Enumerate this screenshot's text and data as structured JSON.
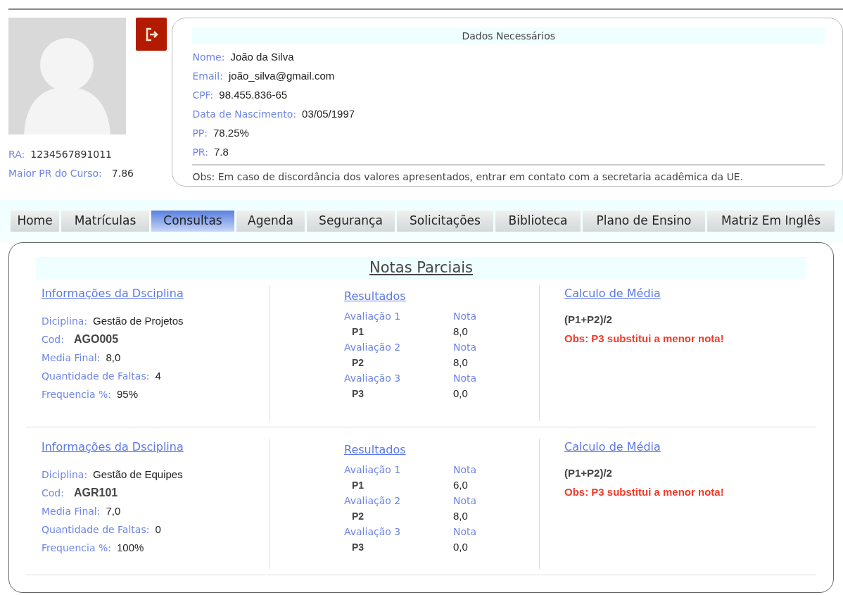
{
  "profile": {
    "ra_label": "RA:",
    "ra": "1234567891011",
    "best_label": "Maior PR do Curso:",
    "best": "7.86"
  },
  "data_panel": {
    "title": "Dados Necessários",
    "fields": [
      {
        "label": "Nome:",
        "value": "João da Silva"
      },
      {
        "label": "Email:",
        "value": "joão_silva@gmail.com"
      },
      {
        "label": "CPF:",
        "value": "98.455.836-65"
      },
      {
        "label": "Data de Nascimento:",
        "value": "03/05/1997"
      },
      {
        "label": "PP:",
        "value": "78.25%"
      },
      {
        "label": "PR:",
        "value": "7.8"
      }
    ],
    "note": "Obs: Em caso de discordância dos valores apresentados, entrar em contato com a secretaria acadêmica da UE."
  },
  "tabs": [
    {
      "label": "Home",
      "selected": false
    },
    {
      "label": "Matrículas",
      "selected": false
    },
    {
      "label": "Consultas",
      "selected": true
    },
    {
      "label": "Agenda",
      "selected": false
    },
    {
      "label": "Segurança",
      "selected": false
    },
    {
      "label": "Solicitações",
      "selected": false
    },
    {
      "label": "Biblioteca",
      "selected": false
    },
    {
      "label": "Plano de Ensino",
      "selected": false
    },
    {
      "label": "Matriz Em Inglês",
      "selected": false
    }
  ],
  "section": {
    "title": "Notas Parciais",
    "disciplines": [
      {
        "info_title": "Informações da Dsciplina",
        "fields": [
          {
            "label": "Diciplina:",
            "value": "Gestão de Projetos",
            "bold": false
          },
          {
            "label": "Cod:",
            "value": "AGO005",
            "bold": true
          },
          {
            "label": "Media Final:",
            "value": "8,0",
            "bold": false
          },
          {
            "label": "Quantidade de Faltas:",
            "value": "4",
            "bold": false
          },
          {
            "label": "Frequencia %:",
            "value": "95%",
            "bold": false
          }
        ],
        "results_title": "Resultados",
        "assessments": [
          {
            "label": "Avaliação 1",
            "nota_label": "Nota",
            "code": "P1",
            "value": "8,0"
          },
          {
            "label": "Avaliação 2",
            "nota_label": "Nota",
            "code": "P2",
            "value": "8,0"
          },
          {
            "label": "Avaliação 3",
            "nota_label": "Nota",
            "code": "P3",
            "value": "0,0"
          }
        ],
        "formula_title": "Calculo de Média",
        "formula": "(P1+P2)/2",
        "note": "Obs: P3 substitui a menor nota!"
      },
      {
        "info_title": "Informações da Dsciplina",
        "fields": [
          {
            "label": "Diciplina:",
            "value": "Gestão de Equipes",
            "bold": false
          },
          {
            "label": "Cod:",
            "value": "AGR101",
            "bold": true
          },
          {
            "label": "Media Final:",
            "value": "7,0",
            "bold": false
          },
          {
            "label": "Quantidade de Faltas:",
            "value": "0",
            "bold": false
          },
          {
            "label": "Frequencia %:",
            "value": "100%",
            "bold": false
          }
        ],
        "results_title": "Resultados",
        "assessments": [
          {
            "label": "Avaliação 1",
            "nota_label": "Nota",
            "code": "P1",
            "value": "6,0"
          },
          {
            "label": "Avaliação 2",
            "nota_label": "Nota",
            "code": "P2",
            "value": "8,0"
          },
          {
            "label": "Avaliação 3",
            "nota_label": "Nota",
            "code": "P3",
            "value": "0,0"
          }
        ],
        "formula_title": "Calculo de Média",
        "formula": "(P1+P2)/2",
        "note": "Obs: P3 substitui a menor nota!"
      }
    ]
  }
}
